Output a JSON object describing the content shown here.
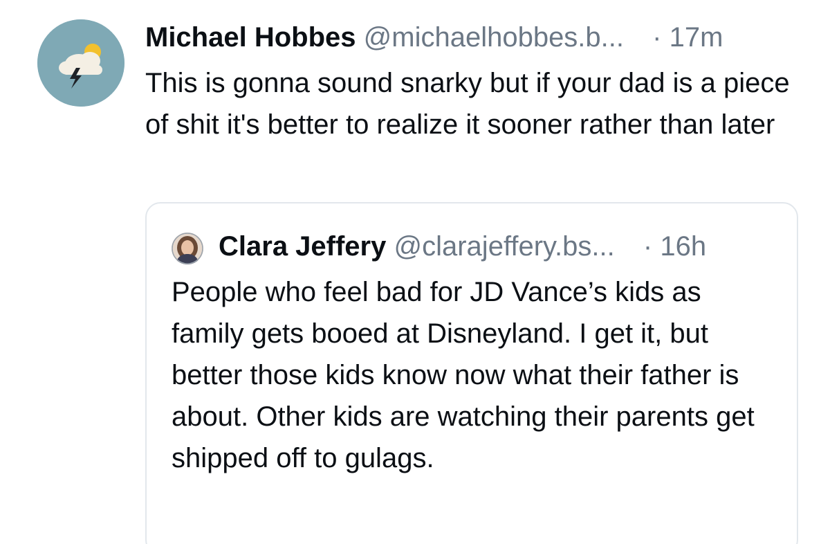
{
  "post": {
    "author_name": "Michael Hobbes",
    "author_handle": "@michaelhobbes.b...",
    "separator": "·",
    "time": "17m",
    "text": "This is gonna sound snarky but if your dad is a piece of shit it's better to realize it sooner rather than later",
    "avatar_icon": "storm-cloud-sun-icon",
    "avatar_color": "#7fa9b5"
  },
  "quote": {
    "author_name": "Clara Jeffery",
    "author_handle": "@clarajeffery.bs...",
    "separator": "·",
    "time": "16h",
    "text": "People who feel bad for JD Vance’s kids as family gets booed at Disneyland. I get it, but better those kids know now what their father is about. Other kids are watching their parents get shipped off to gulags."
  },
  "colors": {
    "text": "#0b0f14",
    "muted": "#6b7785",
    "border": "#e2e7ec"
  }
}
